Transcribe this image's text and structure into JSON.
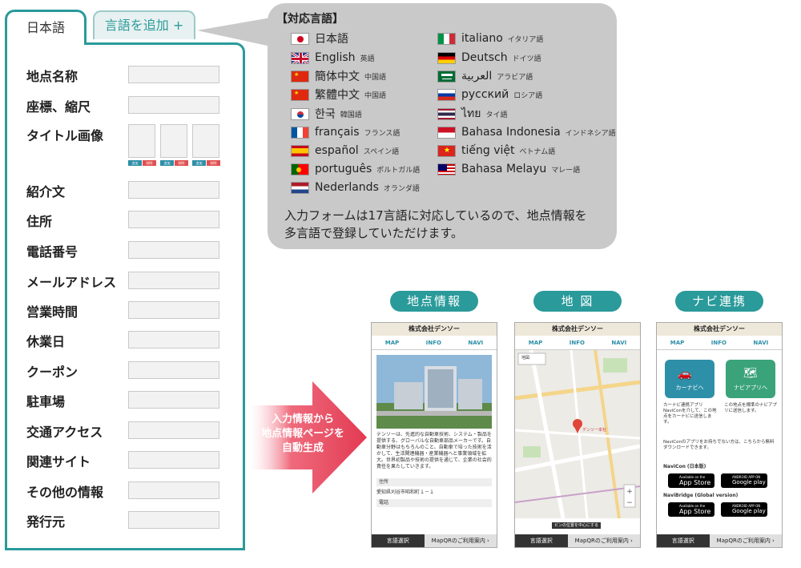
{
  "tabs": {
    "active_label": "日本語",
    "add_label": "言語を追加 +"
  },
  "form": {
    "fields": [
      {
        "label": "地点名称"
      },
      {
        "label": "座標、縮尺"
      },
      {
        "label": "タイトル画像"
      },
      {
        "label": "紹介文"
      },
      {
        "label": "住所"
      },
      {
        "label": "電話番号"
      },
      {
        "label": "メールアドレス"
      },
      {
        "label": "営業時間"
      },
      {
        "label": "休業日"
      },
      {
        "label": "クーポン"
      },
      {
        "label": "駐車場"
      },
      {
        "label": "交通アクセス"
      },
      {
        "label": "関連サイト"
      },
      {
        "label": "その他の情報"
      },
      {
        "label": "発行元"
      }
    ],
    "image_add_label": "追加",
    "image_delete_label": "削除"
  },
  "languages": {
    "title": "【対応言語】",
    "left": [
      {
        "name": "日本語",
        "sub": ""
      },
      {
        "name": "English",
        "sub": "英語"
      },
      {
        "name": "簡体中文",
        "sub": "中国語"
      },
      {
        "name": "繁體中文",
        "sub": "中国語"
      },
      {
        "name": "한국",
        "sub": "韓国語"
      },
      {
        "name": "français",
        "sub": "フランス語"
      },
      {
        "name": "español",
        "sub": "スペイン語"
      },
      {
        "name": "português",
        "sub": "ポルトガル語"
      },
      {
        "name": "Nederlands",
        "sub": "オランダ語"
      }
    ],
    "right": [
      {
        "name": "italiano",
        "sub": "イタリア語"
      },
      {
        "name": "Deutsch",
        "sub": "ドイツ語"
      },
      {
        "name": "العربية",
        "sub": "アラビア語"
      },
      {
        "name": "русский",
        "sub": "ロシア語"
      },
      {
        "name": "ไทย",
        "sub": "タイ語"
      },
      {
        "name": "Bahasa Indonesia",
        "sub": "インドネシア語"
      },
      {
        "name": "tiếng việt",
        "sub": "ベトナム語"
      },
      {
        "name": "Bahasa Melayu",
        "sub": "マレー語"
      }
    ],
    "description_line1": "入力フォームは17言語に対応しているので、地点情報を",
    "description_line2": "多言語で登録していただけます。"
  },
  "arrow": {
    "line1": "入力情報から",
    "line2": "地点情報ページを",
    "line3": "自動生成"
  },
  "phones": {
    "company": "株式会社デンソー",
    "nav": [
      "MAP",
      "INFO",
      "NAVI"
    ],
    "footer_left": "言語選択",
    "footer_right": "MapQRのご利用案内 ›",
    "info": {
      "pill": "地点情報",
      "text": "デンソーは、先進的な自動車技術、システム・製品を提供する、グローバルな自動車部品メーカーです。自動車分野はもちろんのこと、自動車で培った技術を活かして、生活関連機器・産業機器へと事業領域を拡大。世界初製品や技術の提供を通じて、企業の社会的責任を果たしていきます。",
      "address_label": "住所",
      "address": "愛知県刈谷市昭和町１－１",
      "phone_label": "電話"
    },
    "map": {
      "pill": "地 図",
      "pin_label": "デンソー本社",
      "button": "ピンの位置を中心にする",
      "select": "地図"
    },
    "navi": {
      "pill": "ナビ連携",
      "btn1": "カーナビへ",
      "btn2": "ナビアプリへ",
      "text1": "カーナビ連携アプリNaviConを介して、この地点をカーナビに送信します。",
      "text2": "この地点を標準のナビアプリに送信します。",
      "text3": "NaviConのアプリをお持ちでない方は、こちらから無料ダウンロードできます。",
      "label1": "NaviCon (日本版)",
      "label2": "NaviBridge (Global version)",
      "appstore_small": "Available on the",
      "appstore": "App Store",
      "gplay_small": "ANDROID APP ON",
      "gplay": "Google play"
    }
  },
  "colors": {
    "teal": "#2a9a9a",
    "arrow_red": "#e23a52",
    "bubble": "#c9c9c9"
  }
}
